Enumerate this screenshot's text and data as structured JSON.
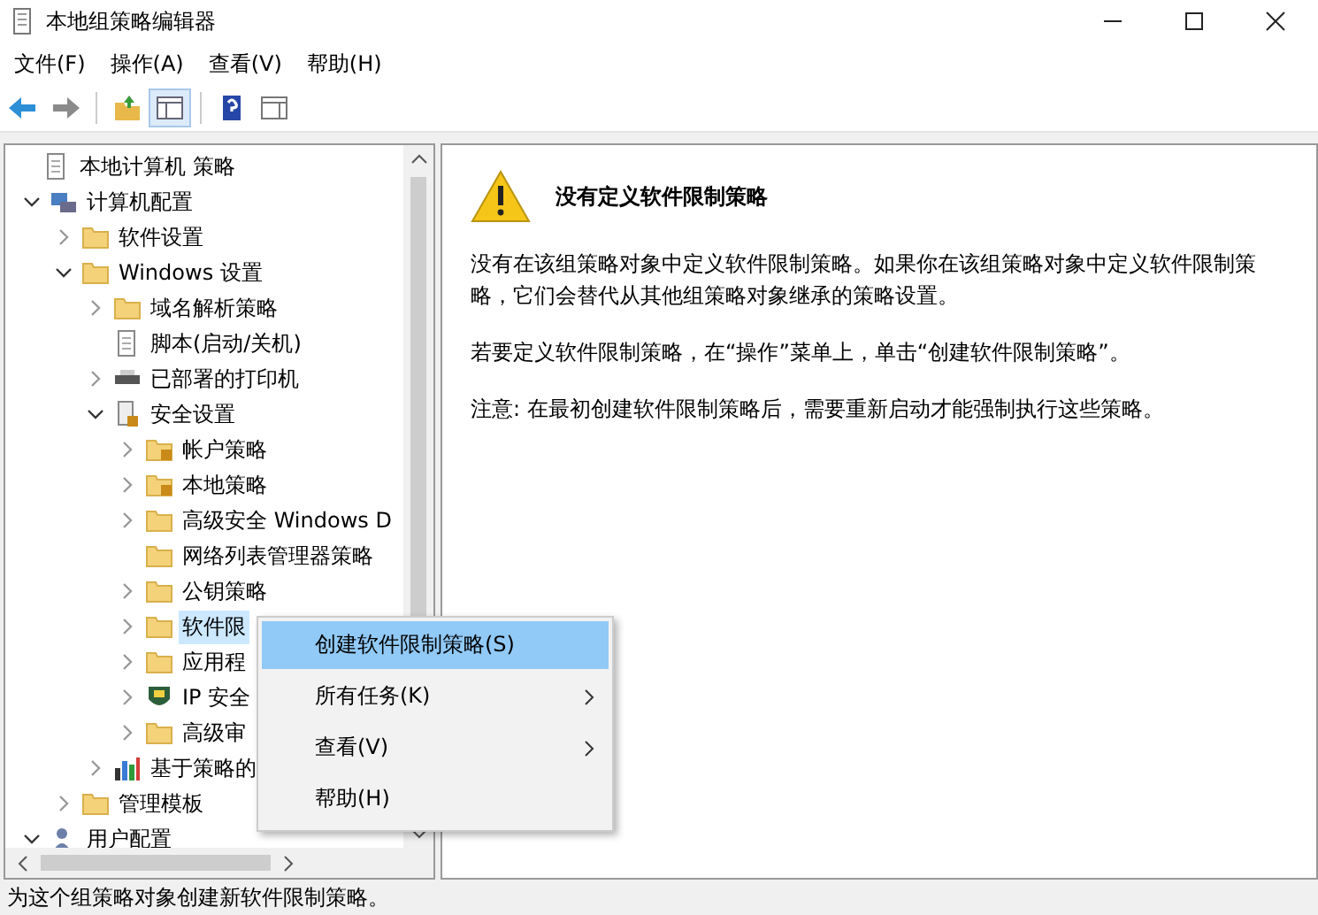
{
  "window": {
    "title": "本地组策略编辑器"
  },
  "menu": [
    "文件(F)",
    "操作(A)",
    "查看(V)",
    "帮助(H)"
  ],
  "toolbar": [
    {
      "kind": "back"
    },
    {
      "kind": "forward"
    },
    {
      "kind": "sep"
    },
    {
      "kind": "up"
    },
    {
      "kind": "pane",
      "selected": true
    },
    {
      "kind": "sep"
    },
    {
      "kind": "help"
    },
    {
      "kind": "view"
    }
  ],
  "tree": [
    {
      "label": "本地计算机 策略",
      "kind": "policy",
      "selected": false,
      "children": [
        {
          "label": "计算机配置",
          "kind": "computer",
          "expanded": true,
          "selected": false,
          "children": [
            {
              "label": "软件设置",
              "kind": "folder",
              "expanded": false,
              "selected": false
            },
            {
              "label": "Windows 设置",
              "kind": "folder",
              "expanded": true,
              "selected": false,
              "children": [
                {
                  "label": "域名解析策略",
                  "kind": "folder",
                  "expanded": false,
                  "selected": false
                },
                {
                  "label": "脚本(启动/关机)",
                  "kind": "script",
                  "selected": false
                },
                {
                  "label": "已部署的打印机",
                  "kind": "printer",
                  "expanded": false,
                  "selected": false
                },
                {
                  "label": "安全设置",
                  "kind": "security",
                  "expanded": true,
                  "selected": false,
                  "children": [
                    {
                      "label": "帐户策略",
                      "kind": "lockfolder",
                      "expanded": false,
                      "selected": false
                    },
                    {
                      "label": "本地策略",
                      "kind": "lockfolder",
                      "expanded": false,
                      "selected": false
                    },
                    {
                      "label": "高级安全 Windows D",
                      "kind": "folder",
                      "expanded": false,
                      "selected": false
                    },
                    {
                      "label": "网络列表管理器策略",
                      "kind": "folder",
                      "selected": false
                    },
                    {
                      "label": "公钥策略",
                      "kind": "folder",
                      "expanded": false,
                      "selected": false
                    },
                    {
                      "label": "软件限",
                      "kind": "folder",
                      "expanded": false,
                      "selected": true
                    },
                    {
                      "label": "应用程",
                      "kind": "folder",
                      "expanded": false,
                      "selected": false
                    },
                    {
                      "label": "IP 安全",
                      "kind": "shield",
                      "expanded": false,
                      "selected": false
                    },
                    {
                      "label": "高级审",
                      "kind": "folder",
                      "expanded": false,
                      "selected": false
                    }
                  ]
                },
                {
                  "label": "基于策略的",
                  "kind": "chart",
                  "expanded": false,
                  "selected": false
                }
              ]
            },
            {
              "label": "管理模板",
              "kind": "folder",
              "expanded": false,
              "selected": false
            }
          ]
        },
        {
          "label": "用户配置",
          "kind": "user",
          "expanded": true,
          "selected": false
        }
      ]
    }
  ],
  "content": {
    "heading": "没有定义软件限制策略",
    "paragraphs": [
      "没有在该组策略对象中定义软件限制策略。如果你在该组策略对象中定义软件限制策略，它们会替代从其他组策略对象继承的策略设置。",
      "若要定义软件限制策略，在“操作”菜单上，单击“创建软件限制策略”。",
      "注意: 在最初创建软件限制策略后，需要重新启动才能强制执行这些策略。"
    ]
  },
  "context_menu": [
    {
      "label": "创建软件限制策略(S)",
      "selected": true,
      "submenu": false
    },
    {
      "label": "所有任务(K)",
      "selected": false,
      "submenu": true
    },
    {
      "label": "查看(V)",
      "selected": false,
      "submenu": true
    },
    {
      "label": "帮助(H)",
      "selected": false,
      "submenu": false
    }
  ],
  "status_bar": "为这个组策略对象创建新软件限制策略。"
}
